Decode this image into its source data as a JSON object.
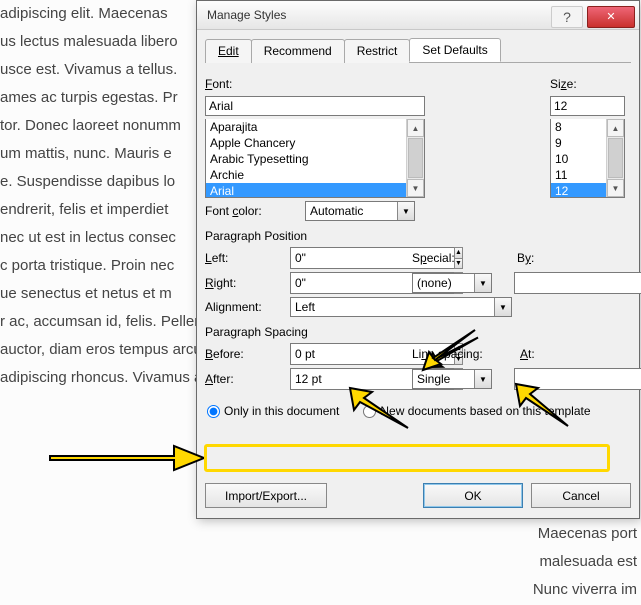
{
  "doc_lines_left": [
    "adipiscing elit. Maecenas",
    "us lectus malesuada libero",
    "usce est. Vivamus a tellus.",
    "ames ac turpis egestas. Pr",
    "tor. Donec laoreet nonumm",
    "um mattis, nunc. Mauris e",
    "",
    "e. Suspendisse dapibus lo",
    "endrerit, felis et imperdiet",
    "nec ut est in lectus consec",
    "c porta tristique. Proin nec",
    "ue senectus et netus et m",
    "",
    "r ac, accumsan id, felis. Pellentesque cursus sagittis felis.",
    "auctor, diam eros tempus arcu, nec vulputate augue",
    "adipiscing rhoncus. Vivamus a mi. Morbi neque. Aliquam"
  ],
  "doc_lines_right": [
    "Maecenas port",
    "malesuada est",
    "Nunc viverra im"
  ],
  "dialog": {
    "title": "Manage Styles",
    "tabs": {
      "edit": "Edit",
      "recommend": "Recommend",
      "restrict": "Restrict",
      "set_defaults": "Set Defaults"
    },
    "font_label": "Font:",
    "font_value": "Arial",
    "font_list": [
      "Aparajita",
      "Apple Chancery",
      "Arabic Typesetting",
      "Archie",
      "Arial"
    ],
    "size_label": "Size:",
    "size_value": "12",
    "size_list": [
      "8",
      "9",
      "10",
      "11",
      "12"
    ],
    "font_color_label": "Font color:",
    "font_color_value": "Automatic",
    "paragraph_position_title": "Paragraph Position",
    "left_label": "Left:",
    "left_value": "0\"",
    "right_label": "Right:",
    "right_value": "0\"",
    "special_label": "Special:",
    "special_value": "(none)",
    "by_label": "By:",
    "by_value": "",
    "alignment_label": "Alignment:",
    "alignment_value": "Left",
    "paragraph_spacing_title": "Paragraph Spacing",
    "before_label": "Before:",
    "before_value": "0 pt",
    "after_label": "After:",
    "after_value": "12 pt",
    "line_spacing_label": "Line spacing:",
    "line_spacing_value": "Single",
    "at_label": "At:",
    "at_value": "",
    "radio_only": "Only in this document",
    "radio_newdocs": "New documents based on this template",
    "import_export": "Import/Export...",
    "ok": "OK",
    "cancel": "Cancel"
  }
}
